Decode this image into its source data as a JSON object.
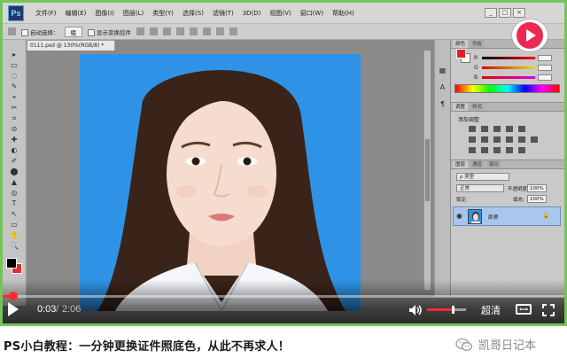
{
  "photoshop": {
    "logo": "Ps",
    "menus": [
      "文件(F)",
      "编辑(E)",
      "图像(I)",
      "图层(L)",
      "类型(Y)",
      "选择(S)",
      "滤镜(T)",
      "3D(D)",
      "视图(V)",
      "窗口(W)",
      "帮助(H)"
    ],
    "window_buttons": [
      "_",
      "□",
      "×"
    ],
    "options": {
      "auto_select_label": "自动选择：",
      "auto_select_value": "组",
      "show_transform_label": "显示变换控件"
    },
    "document_tab": "0111.psd @ 130%(RGB/8) *",
    "tools": [
      "▸",
      "▭",
      "◌",
      "✎",
      "⌖",
      "✂",
      "⌗",
      "⊘",
      "✚",
      "◐",
      "✐",
      "⬤",
      "▲",
      "◎",
      "T",
      "↖",
      "▭",
      "✋",
      "🔍"
    ],
    "panels": {
      "color_tabs": [
        "颜色",
        "色板"
      ],
      "slider_letters": [
        "R",
        "G",
        "B"
      ],
      "adjustments_tabs": [
        "调整",
        "样式"
      ],
      "adjustments_title": "添加调整",
      "layers_tabs": [
        "图层",
        "通道",
        "路径"
      ],
      "layers_filter": "ρ 类型",
      "blend_mode": "正常",
      "opacity_label": "不透明度:",
      "opacity_value": "100%",
      "lock_label": "锁定:",
      "fill_label": "填充:",
      "fill_value": "100%",
      "layer_name": "背景"
    }
  },
  "player": {
    "current_time": "0:03",
    "separator": "/",
    "total_time": "2:06",
    "progress": 0.024,
    "volume": 0.65,
    "quality_label": "超清",
    "widescreen_label": "⟺"
  },
  "caption": {
    "title": "PS小白教程：一分钟更换证件照底色，从此不再求人！",
    "account": "凯哥日记本"
  },
  "colors": {
    "canvas_background": "#2e93e6",
    "frame_green": "#76c35a",
    "progress_red": "#ff2a2a",
    "logo_pink": "#ee2850"
  }
}
